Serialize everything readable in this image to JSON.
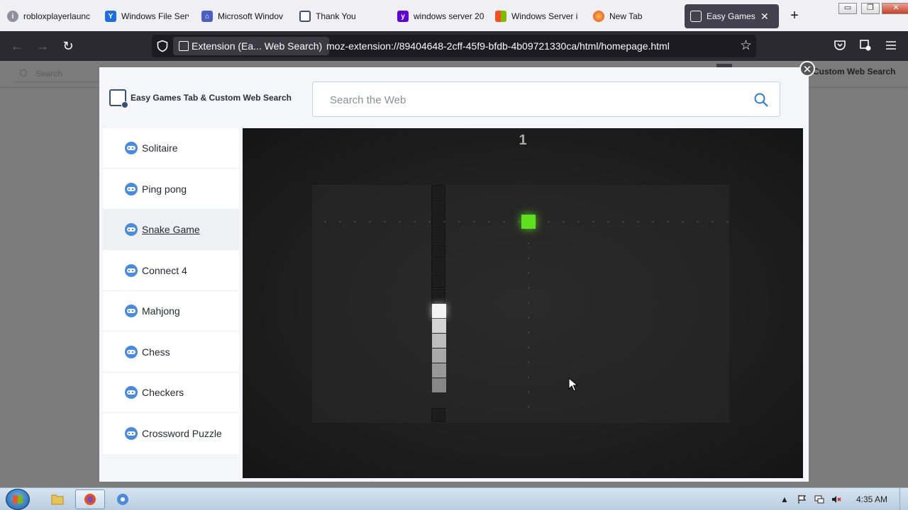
{
  "browser": {
    "tabs": [
      {
        "label": "robloxplayerlaunc",
        "icon": "info-icon",
        "active": false
      },
      {
        "label": "Windows File Serv",
        "icon": "yahoo-icon",
        "active": false
      },
      {
        "label": "Microsoft Windov",
        "icon": "microsoft-community-icon",
        "active": false
      },
      {
        "label": "Thank You",
        "icon": "page-icon",
        "active": false
      },
      {
        "label": "windows server 20",
        "icon": "yahoo-search-icon",
        "active": false
      },
      {
        "label": "Windows Server in",
        "icon": "windows-logo-icon",
        "active": false
      },
      {
        "label": "New Tab",
        "icon": "firefox-icon",
        "active": false
      },
      {
        "label": "Easy Games Tab",
        "icon": "extension-icon",
        "active": true
      }
    ],
    "new_tab_symbol": "+",
    "window_controls": {
      "minimize": "▭",
      "maximize": "❐",
      "close": "✕"
    },
    "identity_label": "Extension (Ea... Web Search)",
    "url": "moz-extension://89404648-2cff-45f9-bfdb-4b09721330ca/html/homepage.html"
  },
  "background_page": {
    "search_placeholder": "Search",
    "brand_partial": "Custom Web Search"
  },
  "modal": {
    "close_symbol": "✕",
    "brand_title": "Easy Games Tab & Custom Web Search",
    "search_placeholder": "Search the Web",
    "games": [
      {
        "label": "Solitaire",
        "selected": false
      },
      {
        "label": "Ping pong",
        "selected": false
      },
      {
        "label": "Snake Game",
        "selected": true
      },
      {
        "label": "Connect 4",
        "selected": false
      },
      {
        "label": "Mahjong",
        "selected": false
      },
      {
        "label": "Chess",
        "selected": false
      },
      {
        "label": "Checkers",
        "selected": false
      },
      {
        "label": "Crossword Puzzle",
        "selected": false
      }
    ],
    "game": {
      "score": "1",
      "food_color": "#5fe01f"
    }
  },
  "taskbar": {
    "clock": "4:35 AM"
  }
}
